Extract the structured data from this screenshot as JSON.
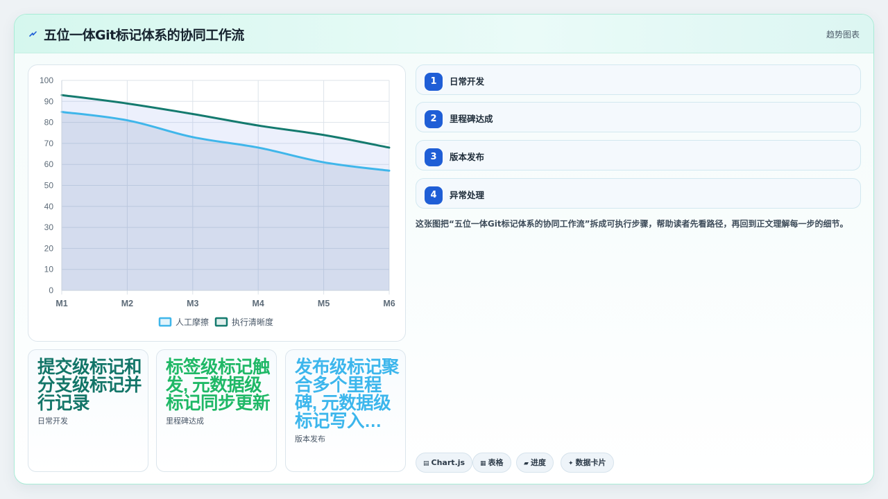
{
  "header": {
    "title": "五位一体Git标记体系的协同工作流",
    "tag": "趋势图表"
  },
  "chart_data": {
    "type": "area",
    "categories": [
      "M1",
      "M2",
      "M3",
      "M4",
      "M5",
      "M6"
    ],
    "ylim": [
      0,
      100
    ],
    "yticks": [
      0,
      10,
      20,
      30,
      40,
      50,
      60,
      70,
      80,
      90,
      100
    ],
    "grid": true,
    "legend_position": "bottom",
    "series": [
      {
        "name": "人工摩擦",
        "color": "#3fb6ea",
        "values": [
          85,
          81,
          73,
          68,
          61,
          57
        ]
      },
      {
        "name": "执行清晰度",
        "color": "#147a6e",
        "values": [
          93,
          89,
          84,
          78.5,
          74,
          68
        ]
      }
    ]
  },
  "stats": [
    {
      "value": "提交级标记和分支级标记并行记录",
      "label": "日常开发",
      "color": "#137568"
    },
    {
      "value": "标签级标记触发, 元数据级标记同步更新",
      "label": "里程碑达成",
      "color": "#1fb866"
    },
    {
      "value": "发布级标记聚合多个里程碑, 元数据级标记写入…",
      "label": "版本发布",
      "color": "#3cb6ec"
    }
  ],
  "steps": [
    {
      "num": "1",
      "label": "日常开发"
    },
    {
      "num": "2",
      "label": "里程碑达成"
    },
    {
      "num": "3",
      "label": "版本发布"
    },
    {
      "num": "4",
      "label": "异常处理"
    }
  ],
  "description": "这张图把“五位一体Git标记体系的协同工作流”拆成可执行步骤，帮助读者先看路径，再回到正文理解每一步的细节。",
  "chips": [
    {
      "icon": "▤",
      "label": "Chart.js"
    },
    {
      "icon": "▦",
      "label": "表格"
    },
    {
      "icon": "▰",
      "label": "进度"
    },
    {
      "icon": "✦",
      "label": "数据卡片"
    }
  ],
  "accent_color": "#1f5ed6"
}
